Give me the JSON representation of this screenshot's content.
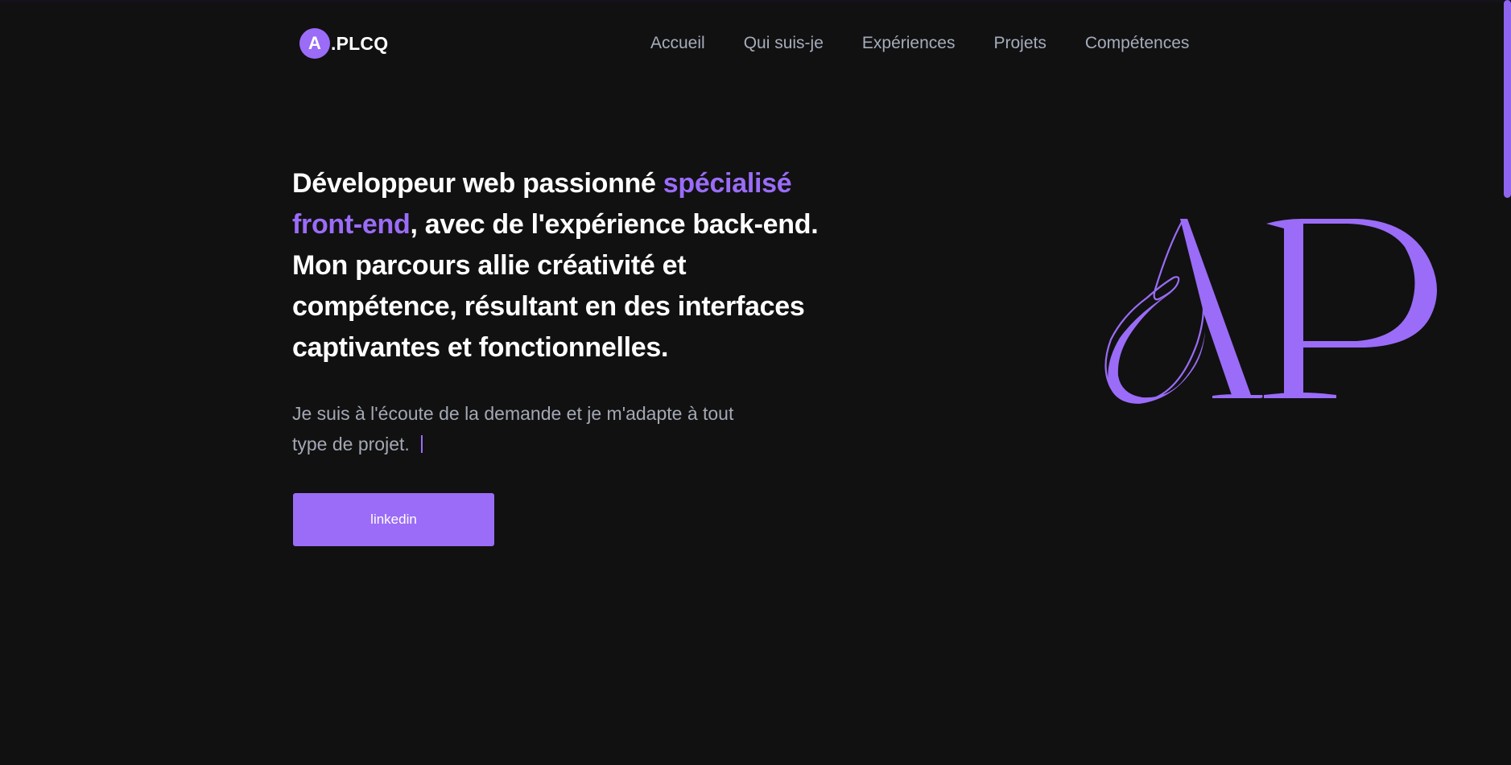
{
  "header": {
    "logo": {
      "badge_letter": "A",
      "text": ".PLCQ"
    },
    "nav": [
      {
        "label": "Accueil"
      },
      {
        "label": "Qui suis-je"
      },
      {
        "label": "Expériences"
      },
      {
        "label": "Projets"
      },
      {
        "label": "Compétences"
      }
    ]
  },
  "hero": {
    "headline_part1": "Développeur web passionné ",
    "headline_accent": "spécialisé front-end",
    "headline_part2": ", avec de l'expérience back-end. Mon parcours allie créativité et compétence, résultant en des interfaces captivantes et fonctionnelles.",
    "subtext": "Je suis à l'écoute de la demande et je m'adapte à tout type de projet.",
    "cta_label": "linkedin",
    "monogram": "AP"
  },
  "colors": {
    "background": "#111111",
    "accent": "#9a6cf7",
    "text": "#ffffff",
    "muted": "#a5acbb"
  },
  "icons": {
    "monogram": "ap-monogram-icon",
    "cursor": "text-cursor-icon"
  }
}
